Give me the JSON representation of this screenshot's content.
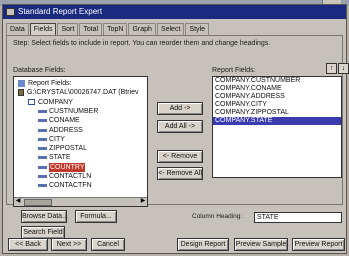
{
  "window": {
    "title": "Standard Report Expert"
  },
  "tabs": [
    {
      "label": "Data",
      "active": false
    },
    {
      "label": "Fields",
      "active": true
    },
    {
      "label": "Sort",
      "active": false
    },
    {
      "label": "Total",
      "active": false
    },
    {
      "label": "TopN",
      "active": false
    },
    {
      "label": "Graph",
      "active": false
    },
    {
      "label": "Select",
      "active": false
    },
    {
      "label": "Style",
      "active": false
    }
  ],
  "step_text": "Step:  Select fields to include in report.  You can reorder them and change headings.",
  "database_fields": {
    "label": "Database Fields:",
    "items": [
      {
        "text": "Report Fields:",
        "kind": "report",
        "level": 0
      },
      {
        "text": "G:\\CRYSTAL\\00026747.DAT (Btriev",
        "kind": "db",
        "level": 0
      },
      {
        "text": "COMPANY",
        "kind": "table",
        "level": 1
      },
      {
        "text": "CUSTNUMBER",
        "kind": "field",
        "level": 2
      },
      {
        "text": "CONAME",
        "kind": "field",
        "level": 2
      },
      {
        "text": "ADDRESS",
        "kind": "field",
        "level": 2
      },
      {
        "text": "CITY",
        "kind": "field",
        "level": 2
      },
      {
        "text": "ZIPPOSTAL",
        "kind": "field",
        "level": 2
      },
      {
        "text": "STATE",
        "kind": "field",
        "level": 2
      },
      {
        "text": "COUNTRY",
        "kind": "field",
        "level": 2,
        "selected": true
      },
      {
        "text": "CONTACTLN",
        "kind": "field",
        "level": 2
      },
      {
        "text": "CONTACTFN",
        "kind": "field",
        "level": 2
      }
    ]
  },
  "report_fields": {
    "label": "Report Fields:",
    "items": [
      "COMPANY.CUSTNUMBER",
      "COMPANY.CONAME",
      "COMPANY.ADDRESS",
      "COMPANY.CITY",
      "COMPANY.ZIPPOSTAL",
      "COMPANY.STATE"
    ],
    "selected_index": 5,
    "order_up": "↑",
    "order_down": "↓"
  },
  "buttons": {
    "add": "Add ->",
    "add_all": "Add All ->",
    "remove": "<- Remove",
    "remove_all": "<- Remove All",
    "browse_data": "Browse Data...",
    "formula": "Formula...",
    "search_field": "Search Field"
  },
  "column_heading": {
    "label": "Column Heading:",
    "value": "STATE"
  },
  "footer": {
    "back": "<< Back",
    "next": "Next >>",
    "cancel": "Cancel",
    "design_report": "Design Report",
    "preview_sample": "Preview Sample",
    "preview_report": "Preview Report"
  },
  "colors": {
    "title_bar": "#1a2a80",
    "selection": "#3b3bb0",
    "tree_selection": "#c0392b"
  }
}
